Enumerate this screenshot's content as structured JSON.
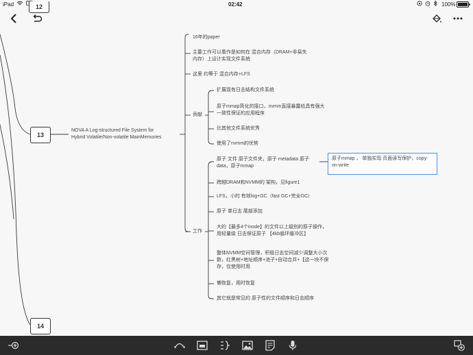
{
  "status": {
    "device": "iPad",
    "time": "02:42",
    "battery": "100%"
  },
  "nav": {
    "partial_top_label": "12"
  },
  "mindmap": {
    "left_top_label": "13",
    "left_bottom_label": "14",
    "central_line1": "NOVA A Log-structured File System for",
    "central_line2": "Hybrid Volatile/Non-volatile MainMemories",
    "top_items": [
      "16年的paper",
      "主要工作可以看作是如何在 混合内存（DRAM+非易失内存）上设计实现文件系统",
      "这里 约等于 混合内存+LFS"
    ],
    "contribution_label": "贡献",
    "contribution_items": [
      "扩展现有日志结构文件系统",
      "原子mmap简化的接口，nvmm直接暴露给具有强大一致性保证的应用程序",
      "比其他文件系统优秀",
      "使用了nvmm的优势"
    ],
    "work_label": "工作",
    "work_items": [
      "原子 文件 原子文件夹，原子 metadata 原子data，原子mmap",
      "跨越DRAM和NVMM的 架构，见figure1",
      "LFS，小的 有效log+GC（fast GC+完全GC）",
      "原子 单日志 尾部添加",
      "大的【最多4个inode】的文件以上级别的原子操作，用轻量级 日志保证原子 【4kb循环缓冲区】",
      "整体NVMM空间管理，积极日志空间减少调整大小次数，红黑树+地址顺序+池子+自动合并+【这一块不保存，仅使用时用",
      "懒恢复，用时恢复",
      "其它就是常见的 原子性的文件顺序和日志顺序"
    ],
    "note": "原子mmap ， 单独实现 页面读写保护，copy-on-write"
  },
  "colors": {
    "line": "#3a3a3a",
    "accent": "#4a90e2",
    "toolbar": "#2b2b2b"
  }
}
